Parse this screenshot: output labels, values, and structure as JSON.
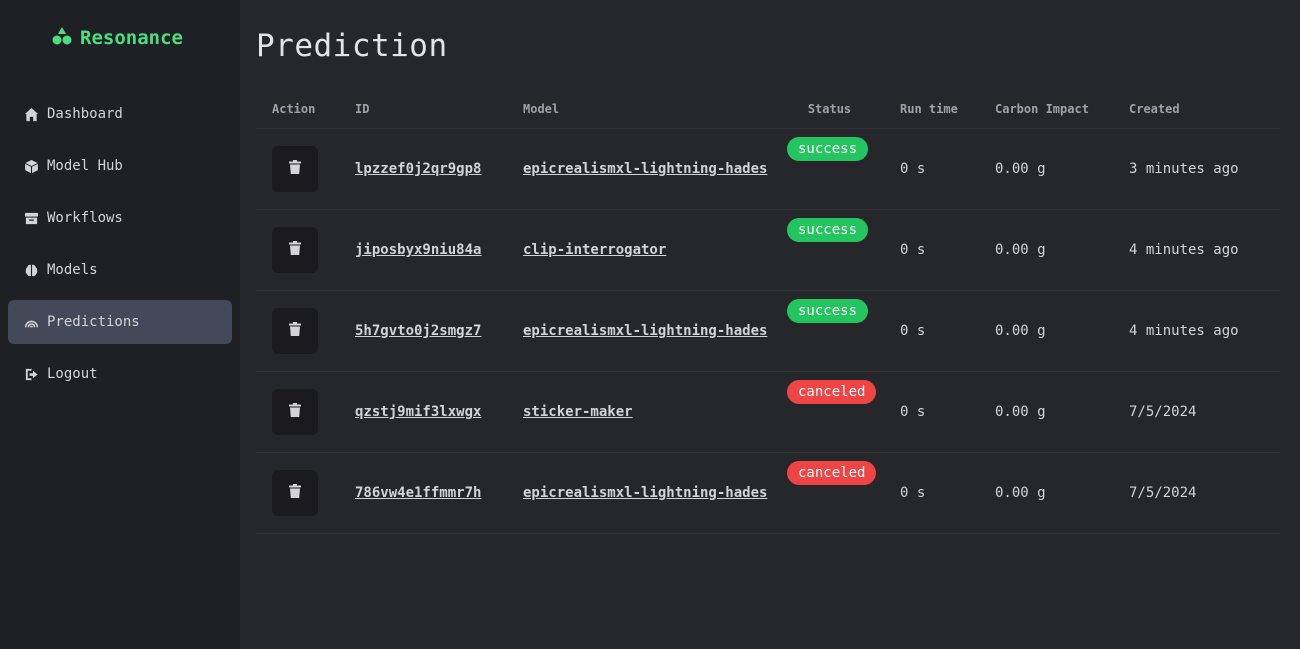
{
  "app": {
    "name": "Resonance",
    "brand_color": "#4ade80"
  },
  "sidebar": {
    "items": [
      {
        "label": "Dashboard",
        "icon": "home-icon"
      },
      {
        "label": "Model Hub",
        "icon": "cube-icon"
      },
      {
        "label": "Workflows",
        "icon": "archive-icon"
      },
      {
        "label": "Models",
        "icon": "brain-icon"
      },
      {
        "label": "Predictions",
        "icon": "rainbow-icon",
        "active": true
      },
      {
        "label": "Logout",
        "icon": "logout-icon"
      }
    ]
  },
  "page": {
    "title": "Prediction"
  },
  "table": {
    "headers": {
      "action": "Action",
      "id": "ID",
      "model": "Model",
      "status": "Status",
      "runtime": "Run time",
      "carbon": "Carbon Impact",
      "created": "Created"
    },
    "rows": [
      {
        "id": "lpzzef0j2qr9gp8",
        "model": "epicrealismxl-lightning-hades",
        "status": "success",
        "runtime": "0 s",
        "carbon": "0.00 g",
        "created": "3 minutes ago"
      },
      {
        "id": "jiposbyx9niu84a",
        "model": "clip-interrogator",
        "status": "success",
        "runtime": "0 s",
        "carbon": "0.00 g",
        "created": "4 minutes ago"
      },
      {
        "id": "5h7gvto0j2smgz7",
        "model": "epicrealismxl-lightning-hades",
        "status": "success",
        "runtime": "0 s",
        "carbon": "0.00 g",
        "created": "4 minutes ago"
      },
      {
        "id": "qzstj9mif3lxwgx",
        "model": "sticker-maker",
        "status": "canceled",
        "runtime": "0 s",
        "carbon": "0.00 g",
        "created": "7/5/2024"
      },
      {
        "id": "786vw4e1ffmmr7h",
        "model": "epicrealismxl-lightning-hades",
        "status": "canceled",
        "runtime": "0 s",
        "carbon": "0.00 g",
        "created": "7/5/2024"
      }
    ]
  },
  "colors": {
    "success": "#22c55e",
    "canceled": "#ef4444",
    "active_nav": "#434958"
  }
}
